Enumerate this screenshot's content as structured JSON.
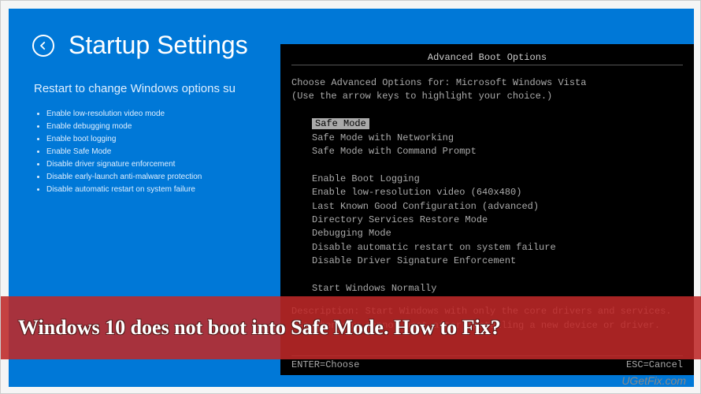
{
  "blue": {
    "title": "Startup Settings",
    "subtitle": "Restart to change Windows options su",
    "items": [
      "Enable low-resolution video mode",
      "Enable debugging mode",
      "Enable boot logging",
      "Enable Safe Mode",
      "Disable driver signature enforcement",
      "Disable early-launch anti-malware protection",
      "Disable automatic restart on system failure"
    ]
  },
  "black": {
    "title": "Advanced Boot Options",
    "prompt1": "Choose Advanced Options for: Microsoft Windows Vista",
    "prompt2": "(Use the arrow keys to highlight your choice.)",
    "selected": "Safe Mode",
    "group1": [
      "Safe Mode with Networking",
      "Safe Mode with Command Prompt"
    ],
    "group2": [
      "Enable Boot Logging",
      "Enable low-resolution video (640x480)",
      "Last Known Good Configuration (advanced)",
      "Directory Services Restore Mode",
      "Debugging Mode",
      "Disable automatic restart on system failure",
      "Disable Driver Signature Enforcement"
    ],
    "group3": [
      "Start Windows Normally"
    ],
    "desc_label": "Description:",
    "desc_text": "Start Windows with only the core drivers and services. Use when you cannot boot after installing a new device or driver.",
    "footer_left": "ENTER=Choose",
    "footer_right": "ESC=Cancel"
  },
  "banner": {
    "text": "Windows 10 does not boot into Safe Mode. How to Fix?"
  },
  "watermark": "UGetFix.com"
}
